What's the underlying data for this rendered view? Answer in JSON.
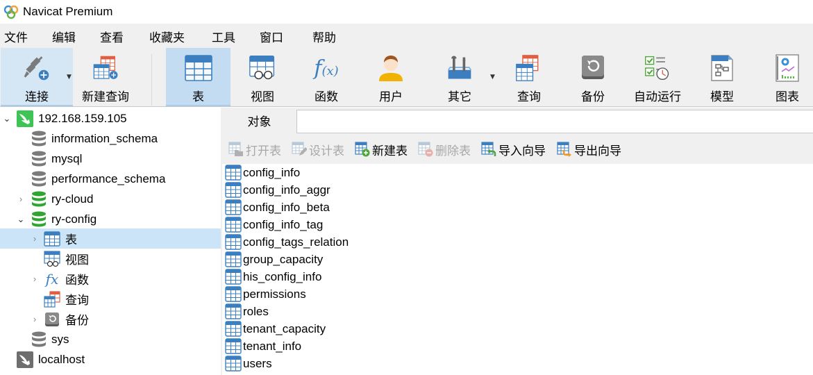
{
  "window": {
    "title": "Navicat Premium"
  },
  "menu": [
    "文件",
    "编辑",
    "查看",
    "收藏夹",
    "工具",
    "窗口",
    "帮助"
  ],
  "toolbar": {
    "connect": "连接",
    "new_query": "新建查询",
    "table": "表",
    "view": "视图",
    "function": "函数",
    "user": "用户",
    "other": "其它",
    "query": "查询",
    "backup": "备份",
    "automation": "自动运行",
    "model": "模型",
    "chart": "图表"
  },
  "tree": {
    "connection": "192.168.159.105",
    "databases": [
      {
        "name": "information_schema",
        "state": "closed"
      },
      {
        "name": "mysql",
        "state": "closed"
      },
      {
        "name": "performance_schema",
        "state": "closed"
      },
      {
        "name": "ry-cloud",
        "state": "open"
      },
      {
        "name": "ry-config",
        "state": "open-expanded"
      }
    ],
    "children": {
      "tables": "表",
      "views": "视图",
      "functions": "函数",
      "queries": "查询",
      "backups": "备份"
    },
    "sys": "sys",
    "localhost": "localhost"
  },
  "tabs": {
    "objects": "对象"
  },
  "object_toolbar": {
    "open_table": "打开表",
    "design_table": "设计表",
    "new_table": "新建表",
    "delete_table": "删除表",
    "import_wizard": "导入向导",
    "export_wizard": "导出向导"
  },
  "tables": [
    "config_info",
    "config_info_aggr",
    "config_info_beta",
    "config_info_tag",
    "config_tags_relation",
    "group_capacity",
    "his_config_info",
    "permissions",
    "roles",
    "tenant_capacity",
    "tenant_info",
    "users"
  ],
  "colors": {
    "accent_blue": "#3d86c6",
    "selection": "#cce4f7",
    "toolbar_active": "#c4dcf2",
    "db_open_green": "#2fa52f",
    "db_closed_gray": "#7a7a7a",
    "mysql_green": "#3ec455"
  }
}
